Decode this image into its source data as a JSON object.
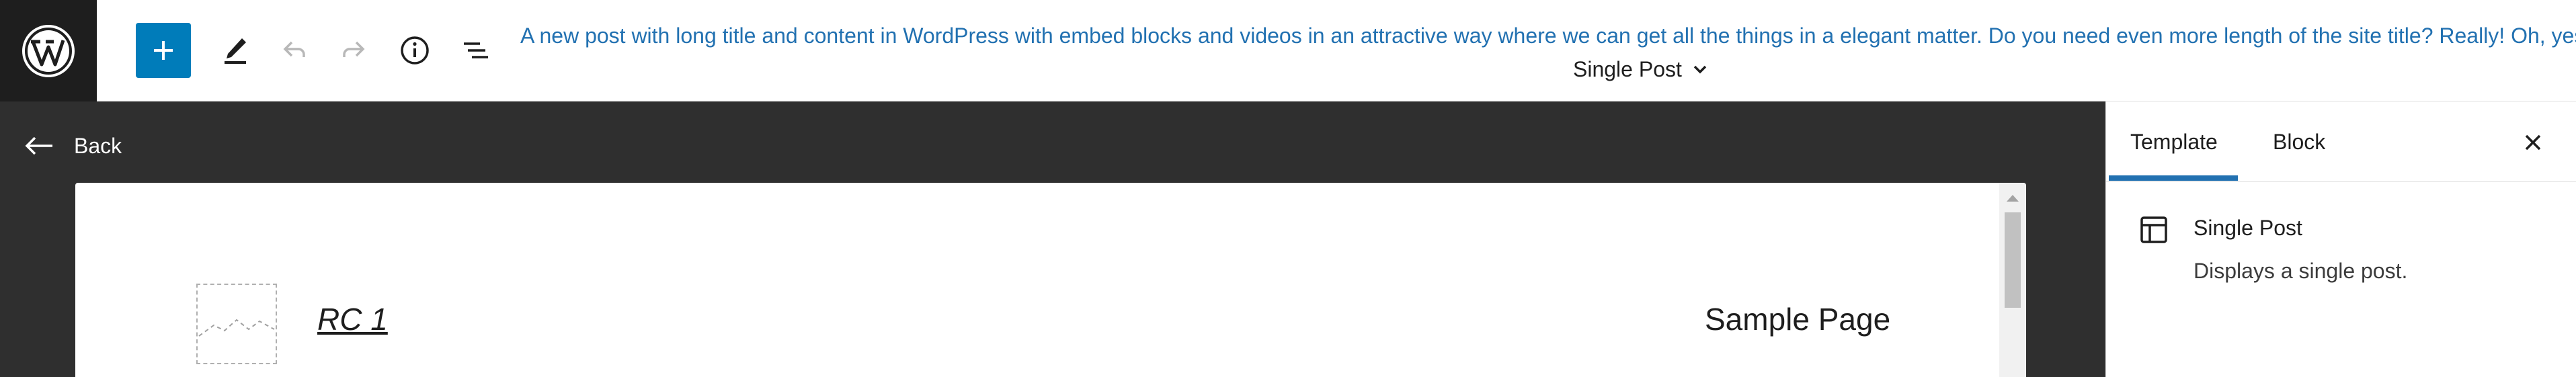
{
  "header": {
    "site_title": "A new post with long title and content in WordPress with embed blocks and videos in an attractive way where we can get all the things in a elegant matter. Do you need even more length of the site title? Really! Oh, yes!",
    "template_switcher_label": "Single Post"
  },
  "editor": {
    "back_label": "Back",
    "site_name": "RC 1",
    "nav_item": "Sample Page"
  },
  "sidebar": {
    "tabs": [
      {
        "label": "Template",
        "active": true
      },
      {
        "label": "Block",
        "active": false
      }
    ],
    "template": {
      "title": "Single Post",
      "description": "Displays a single post."
    }
  },
  "colors": {
    "accent": "#007cba",
    "link_blue": "#2271b1",
    "dark_bg": "#2f2f2f",
    "logo_bg": "#1e1e1e"
  },
  "icons": [
    "wordpress-logo-icon",
    "plus-icon",
    "pencil-icon",
    "undo-icon",
    "redo-icon",
    "info-icon",
    "list-view-icon",
    "chevron-down-icon",
    "arrow-left-icon",
    "close-icon",
    "layout-icon"
  ]
}
